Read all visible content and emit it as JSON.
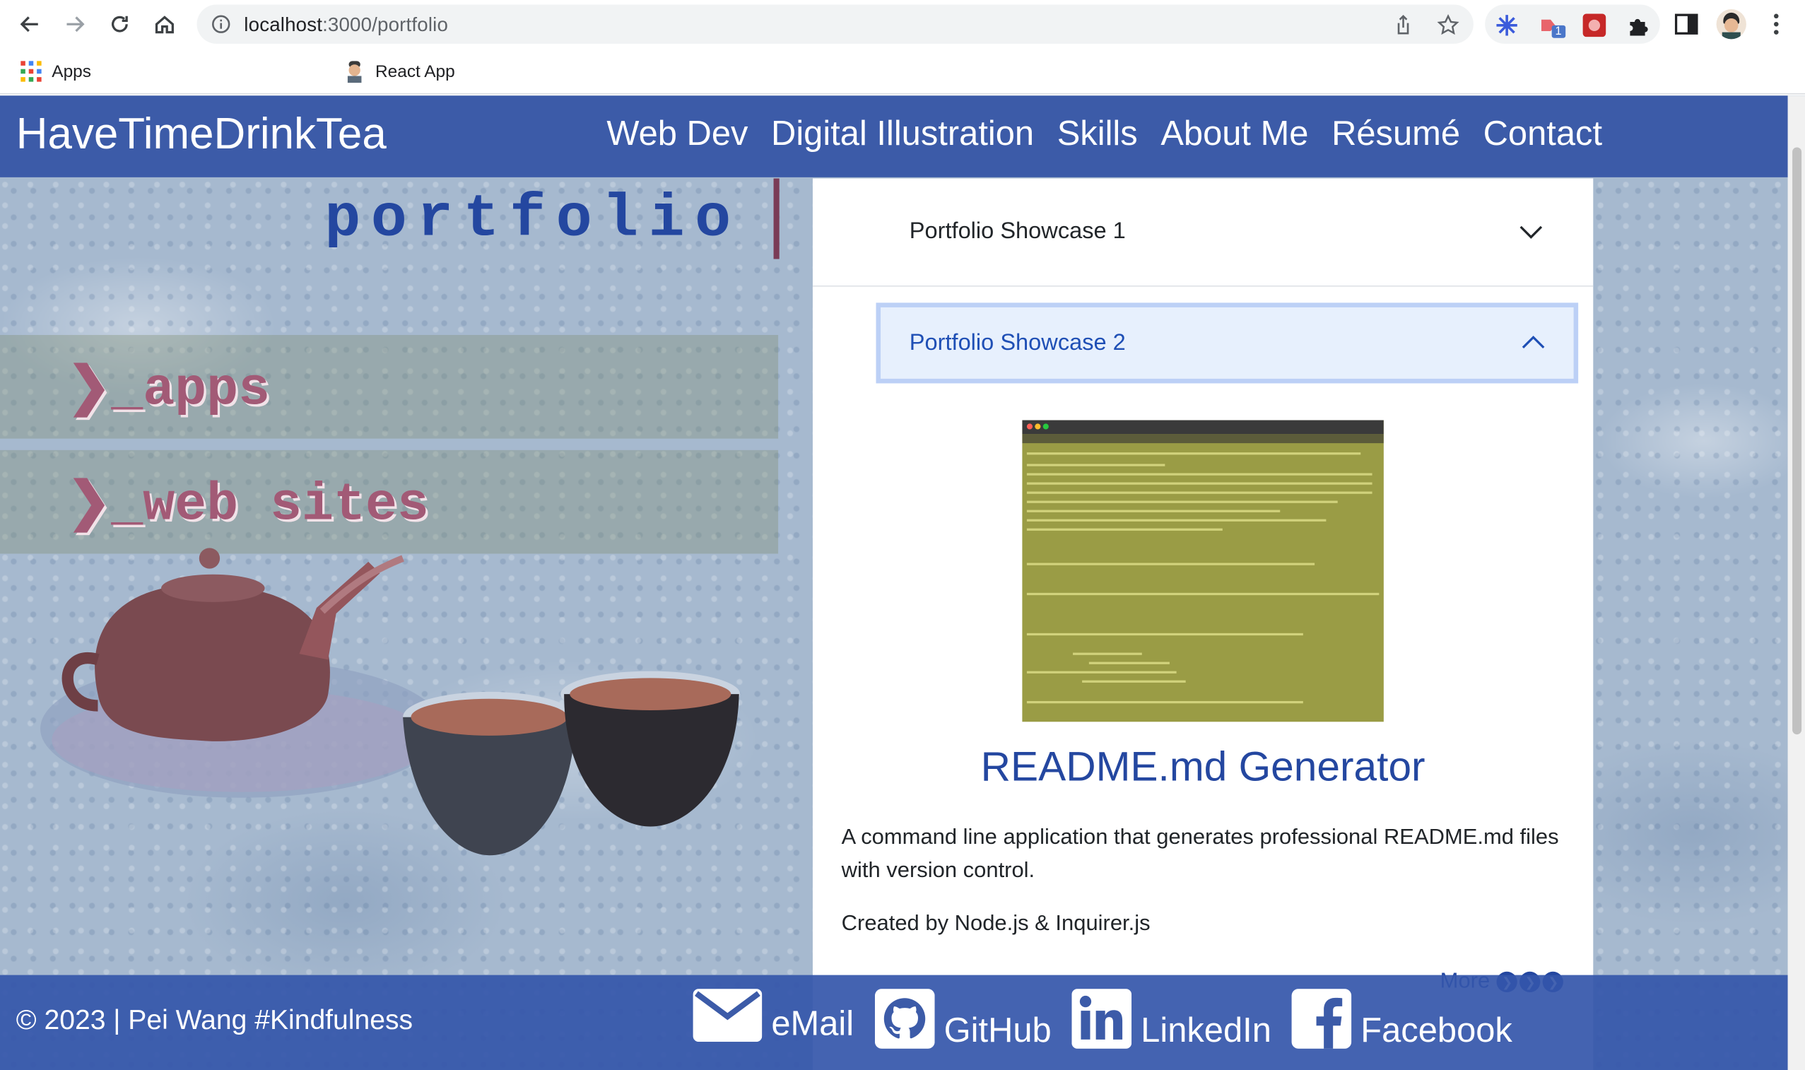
{
  "browser": {
    "url_host": "localhost",
    "url_path": ":3000/portfolio",
    "extension_badge": "1",
    "bookmarks": [
      {
        "label": "Apps",
        "icon": "apps-grid-icon"
      },
      {
        "label": "",
        "icon": "google-drive-icon"
      },
      {
        "label": "",
        "icon": "globe-icon"
      },
      {
        "label": "",
        "icon": "google-sheets-icon"
      },
      {
        "label": "",
        "icon": "globe-icon"
      },
      {
        "label": "",
        "icon": "globe-icon"
      },
      {
        "label": "React App",
        "icon": "profile-favicon-icon"
      }
    ]
  },
  "site": {
    "brand": "HaveTimeDrinkTea",
    "nav": [
      "Web Dev",
      "Digital Illustration",
      "Skills",
      "About Me",
      "Résumé",
      "Contact"
    ],
    "hero_title": "portfolio",
    "menu": [
      "❯_apps",
      "❯_web sites"
    ]
  },
  "accordion": {
    "item1_title": "Portfolio Showcase 1",
    "item2_title": "Portfolio Showcase 2",
    "project_title": "README.md Generator",
    "description": "A command line application that generates professional README.md files with version control.",
    "created_by": "Created by Node.js & Inquirer.js",
    "more_label": "More"
  },
  "footer": {
    "copyright": "© 2023 | Pei Wang #Kindfulness",
    "links": [
      {
        "label": "eMail",
        "icon": "envelope-icon"
      },
      {
        "label": "GitHub",
        "icon": "github-icon"
      },
      {
        "label": "LinkedIn",
        "icon": "linkedin-icon"
      },
      {
        "label": "Facebook",
        "icon": "facebook-icon"
      }
    ]
  },
  "colors": {
    "navbar": "#3c5ba8",
    "accent": "#2447a0",
    "menu_text": "#a25a76"
  }
}
